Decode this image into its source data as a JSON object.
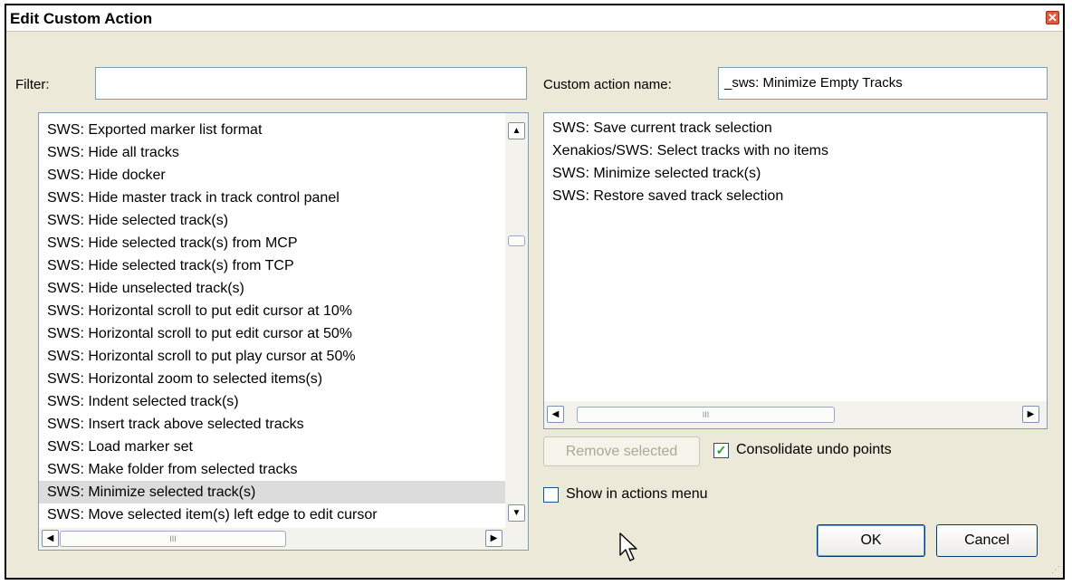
{
  "window": {
    "title": "Edit Custom Action",
    "close_glyph": "✕"
  },
  "filter": {
    "label": "Filter:",
    "value": ""
  },
  "name": {
    "label": "Custom action name:",
    "value": "_sws: Minimize Empty Tracks"
  },
  "action_list": {
    "items": [
      "SWS: Exported marker list format",
      "SWS: Hide all tracks",
      "SWS: Hide docker",
      "SWS: Hide master track in track control panel",
      "SWS: Hide selected track(s)",
      "SWS: Hide selected track(s) from MCP",
      "SWS: Hide selected track(s) from TCP",
      "SWS: Hide unselected track(s)",
      "SWS: Horizontal scroll to put edit cursor at 10%",
      "SWS: Horizontal scroll to put edit cursor at 50%",
      "SWS: Horizontal scroll to put play cursor at 50%",
      "SWS: Horizontal zoom to selected items(s)",
      "SWS: Indent selected track(s)",
      "SWS: Insert track above selected tracks",
      "SWS: Load marker set",
      "SWS: Make folder from selected tracks",
      "SWS: Minimize selected track(s)",
      "SWS: Move selected item(s) left edge to edit cursor"
    ],
    "selected_index": 16
  },
  "custom_list": {
    "items": [
      "SWS: Save current track selection",
      "Xenakios/SWS: Select tracks with no items",
      "SWS: Minimize selected track(s)",
      "SWS: Restore saved track selection"
    ]
  },
  "scroll": {
    "up": "▲",
    "down": "▼",
    "left": "◀",
    "right": "▶",
    "thumb_grip": "III"
  },
  "buttons": {
    "remove": "Remove selected",
    "ok": "OK",
    "cancel": "Cancel"
  },
  "checkboxes": {
    "consolidate": {
      "label": "Consolidate undo points",
      "checked": true,
      "mark": "✓"
    },
    "show_in_menu": {
      "label": "Show in actions menu",
      "checked": false
    }
  },
  "icons": {
    "close": "close-icon",
    "cursor": "mouse-pointer-icon",
    "grip": "size-grip-icon"
  },
  "colors": {
    "dialog_bg": "#ece9d8",
    "border": "#7f9db9",
    "selection": "#dcdcdc",
    "check": "#21a121",
    "close": "#e35a3c"
  }
}
